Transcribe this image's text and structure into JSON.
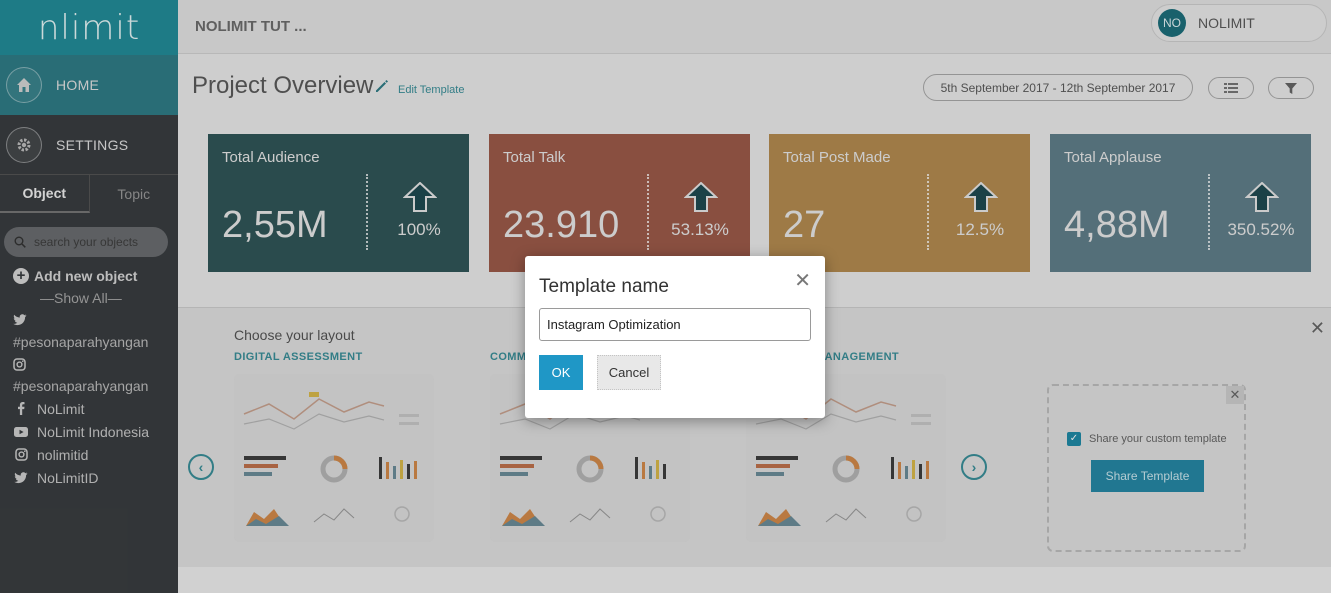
{
  "app": {
    "logo_text": "nlimit",
    "project_name": "NOLIMIT TUT ...",
    "user": {
      "initials": "NO",
      "name": "NOLIMIT"
    }
  },
  "sidebar": {
    "nav": [
      {
        "label": "HOME",
        "icon": "home-icon"
      },
      {
        "label": "SETTINGS",
        "icon": "gear-icon"
      }
    ],
    "tabs": [
      {
        "label": "Object",
        "active": true
      },
      {
        "label": "Topic",
        "active": false
      }
    ],
    "search_placeholder": "search your objects",
    "add_object_label": "Add new object",
    "show_all_label": "—Show All—",
    "objects": [
      {
        "icon": "twitter-icon",
        "label": ""
      },
      {
        "icon": "",
        "label": "#pesonaparahyangan"
      },
      {
        "icon": "instagram-icon",
        "label": ""
      },
      {
        "icon": "",
        "label": "#pesonaparahyangan"
      },
      {
        "icon": "facebook-icon",
        "label": "NoLimit"
      },
      {
        "icon": "youtube-icon",
        "label": "NoLimit Indonesia"
      },
      {
        "icon": "instagram-icon",
        "label": "nolimitid"
      },
      {
        "icon": "twitter-icon",
        "label": "NoLimitID"
      }
    ]
  },
  "header": {
    "title": "Project Overview",
    "edit_label": "Edit Template",
    "date_range": "5th September 2017 - 12th September 2017"
  },
  "cards": [
    {
      "title": "Total Audience",
      "value": "2,55M",
      "change": "100%",
      "color": "#305658"
    },
    {
      "title": "Total Talk",
      "value": "23.910",
      "change": "53.13%",
      "color": "#9c5a49"
    },
    {
      "title": "Total Post Made",
      "value": "27",
      "change": "12.5%",
      "color": "#b48b50"
    },
    {
      "title": "Total Applause",
      "value": "4,88M",
      "change": "350.52%",
      "color": "#607f8a"
    }
  ],
  "layout_panel": {
    "heading": "Choose your layout",
    "templates": [
      "DIGITAL ASSESSMENT",
      "COMM",
      "MANAGEMENT"
    ],
    "share_checkbox_label": "Share your custom template",
    "share_button_label": "Share Template"
  },
  "modal": {
    "title": "Template name",
    "input_value": "Instagram Optimization",
    "ok_label": "OK",
    "cancel_label": "Cancel"
  }
}
